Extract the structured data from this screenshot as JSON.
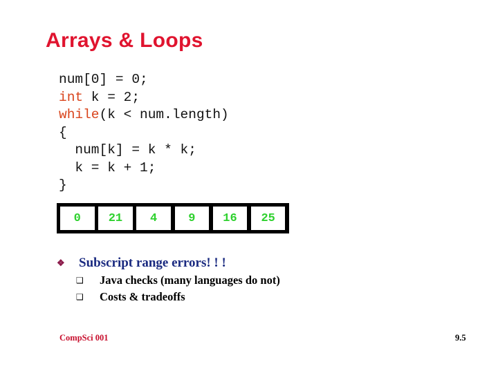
{
  "slide": {
    "title": "Arrays & Loops",
    "code_lines": [
      {
        "keyword": "",
        "rest": "num[0] = 0;"
      },
      {
        "keyword": "int",
        "rest": " k = 2;"
      },
      {
        "keyword": "while",
        "rest": "(k < num.length)"
      },
      {
        "keyword": "",
        "rest": "{"
      },
      {
        "keyword": "",
        "rest": "  num[k] = k * k;"
      },
      {
        "keyword": "",
        "rest": "  k = k + 1;"
      },
      {
        "keyword": "",
        "rest": "}"
      }
    ],
    "array_values": [
      "0",
      "21",
      "4",
      "9",
      "16",
      "25"
    ],
    "bullets": [
      {
        "marker": "❖",
        "text": "Subscript range errors! ! !",
        "sub": [
          {
            "marker": "❑",
            "text": "Java checks (many languages do not)"
          },
          {
            "marker": "❑",
            "text": "Costs & tradeoffs"
          }
        ]
      }
    ],
    "footer": {
      "course": "CompSci 001",
      "slide_number": "9.5"
    },
    "colors": {
      "title": "#e0142f",
      "keyword": "#d9441c",
      "array_value": "#2ed12e",
      "bullet_l1_text": "#1a2a80",
      "bullet_l1_marker": "#8b1a4a",
      "footer_course": "#c8102e"
    }
  }
}
